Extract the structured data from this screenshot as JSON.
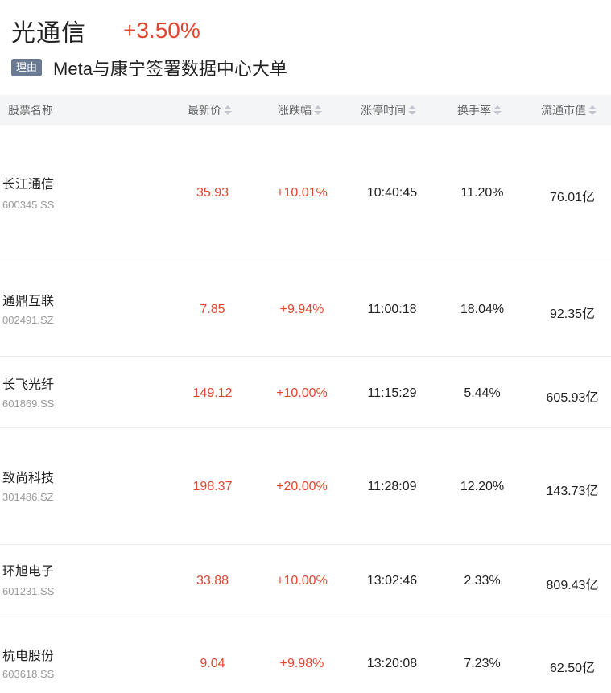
{
  "header": {
    "name": "光通信",
    "change": "+3.50%"
  },
  "reason": {
    "tag": "理由",
    "text": "Meta与康宁签署数据中心大单"
  },
  "columns": [
    "股票名称",
    "最新价",
    "涨跌幅",
    "涨停时间",
    "换手率",
    "流通市值"
  ],
  "rows": [
    {
      "name": "长江通信",
      "code": "600345.SS",
      "price": "35.93",
      "change": "+10.01%",
      "time": "10:40:45",
      "turnover": "11.20%",
      "cap": "76.01亿"
    },
    {
      "name": "通鼎互联",
      "code": "002491.SZ",
      "price": "7.85",
      "change": "+9.94%",
      "time": "11:00:18",
      "turnover": "18.04%",
      "cap": "92.35亿"
    },
    {
      "name": "长飞光纤",
      "code": "601869.SS",
      "price": "149.12",
      "change": "+10.00%",
      "time": "11:15:29",
      "turnover": "5.44%",
      "cap": "605.93亿"
    },
    {
      "name": "致尚科技",
      "code": "301486.SZ",
      "price": "198.37",
      "change": "+20.00%",
      "time": "11:28:09",
      "turnover": "12.20%",
      "cap": "143.73亿"
    },
    {
      "name": "环旭电子",
      "code": "601231.SS",
      "price": "33.88",
      "change": "+10.00%",
      "time": "13:02:46",
      "turnover": "2.33%",
      "cap": "809.43亿"
    },
    {
      "name": "杭电股份",
      "code": "603618.SS",
      "price": "9.04",
      "change": "+9.98%",
      "time": "13:20:08",
      "turnover": "7.23%",
      "cap": "62.50亿"
    }
  ],
  "colors": {
    "up": "#e2462f",
    "header_bg": "#f4f5f7",
    "tag_bg": "#6b7a93"
  }
}
